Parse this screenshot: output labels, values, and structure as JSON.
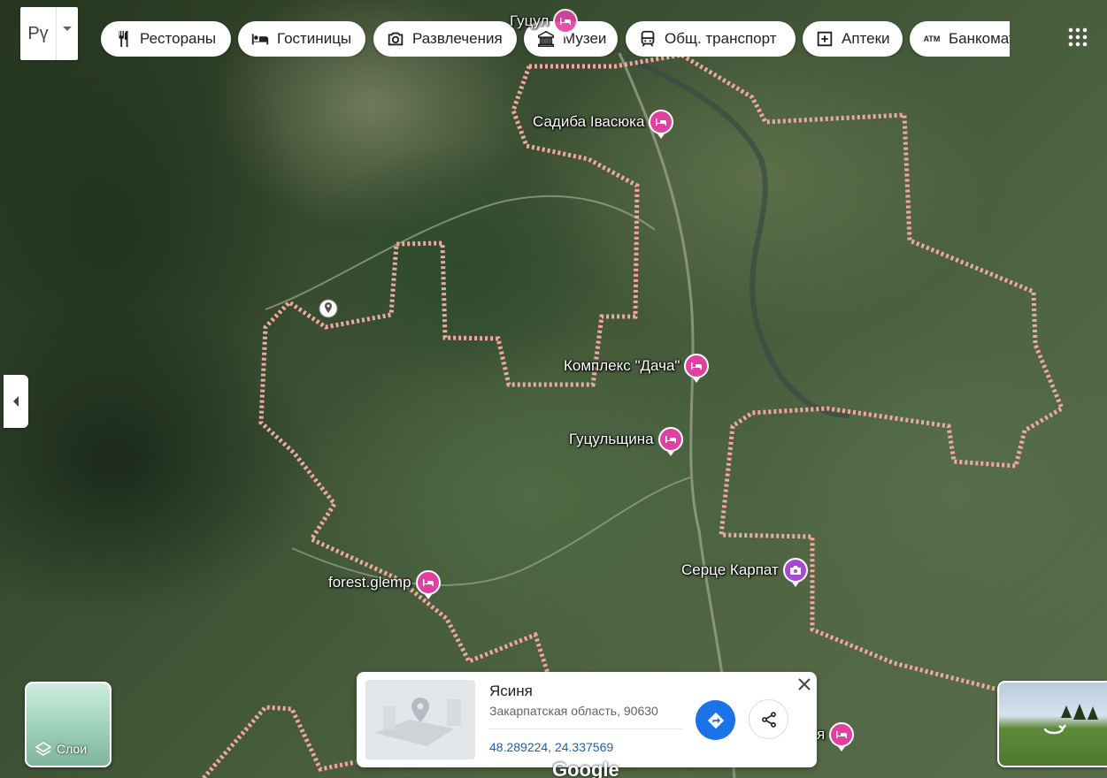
{
  "language_switch": {
    "code": "Рү"
  },
  "categories": [
    {
      "label": "Рестораны",
      "icon": "restaurant-icon"
    },
    {
      "label": "Гостиницы",
      "icon": "hotel-icon"
    },
    {
      "label": "Развлечения",
      "icon": "camera-icon"
    },
    {
      "label": "Музеи",
      "icon": "museum-icon"
    },
    {
      "label": "Общ. транспорт",
      "icon": "transit-icon"
    },
    {
      "label": "Аптеки",
      "icon": "pharmacy-icon"
    },
    {
      "label": "Банкоматы",
      "icon": "atm-icon"
    }
  ],
  "atm_icon_text": "ATM",
  "places": [
    {
      "name": "Садиба Івасюка",
      "type": "hotel"
    },
    {
      "name": "Комплекс \"Дача\"",
      "type": "hotel"
    },
    {
      "name": "Гуцульщина",
      "type": "hotel"
    },
    {
      "name": "forest.glemp",
      "type": "hotel"
    },
    {
      "name": "Серце Карпат",
      "type": "attraction"
    },
    {
      "name": "Гуцул",
      "type": "hotel"
    },
    {
      "name": "я",
      "type": "hotel"
    }
  ],
  "layers": {
    "label": "Слои"
  },
  "info_card": {
    "title": "Ясиня",
    "subtitle": "Закарпатская область, 90630",
    "coordinates": "48.289224, 24.337569"
  },
  "map_attribution": "Google",
  "colors": {
    "hotel_pin": "#e040a0",
    "attraction_pin": "#a64ad6",
    "boundary": "#f0a8a0",
    "directions_button": "#1a73e8",
    "coordinates_link": "#1a5fb4"
  }
}
